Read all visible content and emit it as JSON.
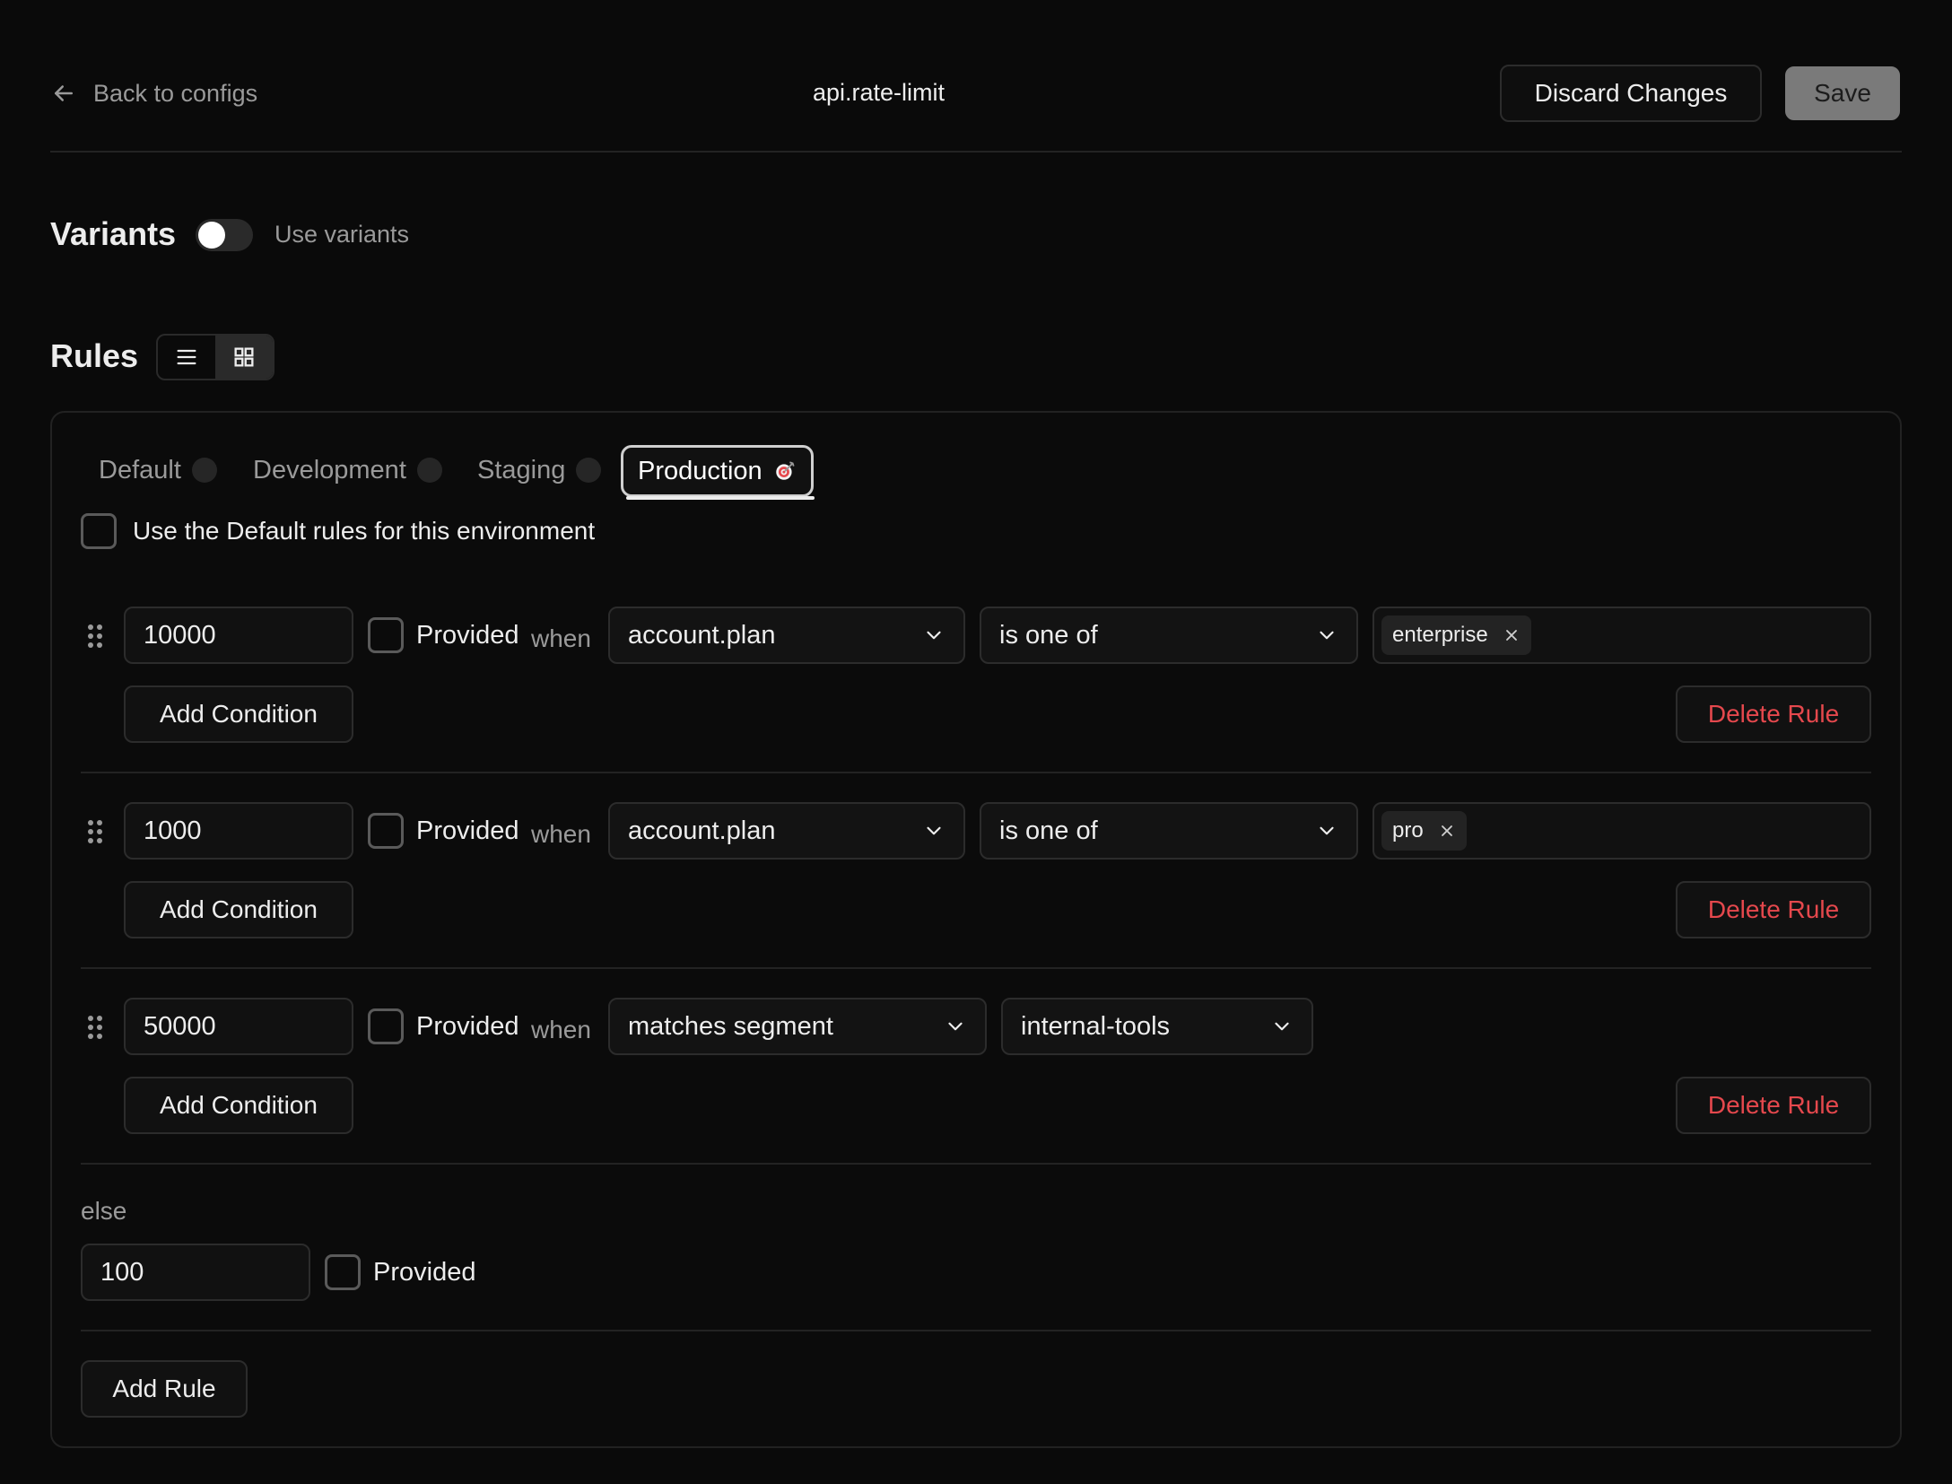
{
  "header": {
    "back_label": "Back to configs",
    "title": "api.rate-limit",
    "discard_label": "Discard Changes",
    "save_label": "Save"
  },
  "variants": {
    "title": "Variants",
    "toggle_label": "Use variants",
    "enabled": false
  },
  "rules": {
    "title": "Rules",
    "view_modes": [
      "list-icon",
      "grid-icon"
    ],
    "active_view": "grid-icon",
    "tabs": [
      {
        "label": "Default",
        "active": false
      },
      {
        "label": "Development",
        "active": false
      },
      {
        "label": "Staging",
        "active": false
      },
      {
        "label": "Production",
        "active": true,
        "icon": "target-icon"
      }
    ],
    "use_default_label": "Use the Default rules for this environment",
    "provided_label": "Provided",
    "when_label": "when",
    "add_condition_label": "Add Condition",
    "delete_rule_label": "Delete Rule",
    "items": [
      {
        "value": "10000",
        "attribute": "account.plan",
        "operator": "is one of",
        "chips": [
          "enterprise"
        ]
      },
      {
        "value": "1000",
        "attribute": "account.plan",
        "operator": "is one of",
        "chips": [
          "pro"
        ]
      },
      {
        "value": "50000",
        "attribute": "matches segment",
        "segment": "internal-tools"
      }
    ],
    "else_label": "else",
    "else_value": "100",
    "add_rule_label": "Add Rule"
  },
  "colors": {
    "background": "#0a0a0a",
    "danger": "#e5484d",
    "muted": "#9a9a9a"
  }
}
